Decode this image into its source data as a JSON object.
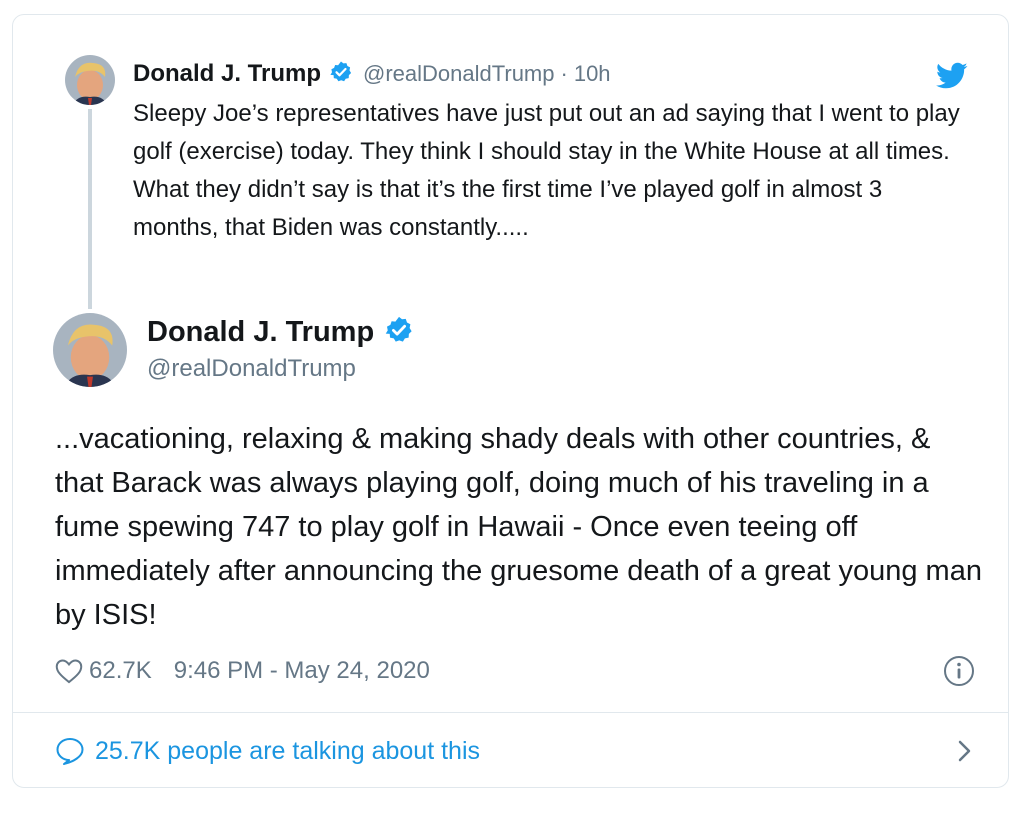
{
  "parent_tweet": {
    "author_name": "Donald J. Trump",
    "handle": "@realDonaldTrump",
    "separator": "·",
    "time_ago": "10h",
    "text": "Sleepy Joe’s representatives have just put out an ad saying that I went to play golf (exercise) today. They think I should stay in the White House at all times. What they didn’t say is that it’s the first time I’ve played golf in almost 3 months, that Biden was constantly.....",
    "verified_icon": "verified-badge-icon",
    "brand_icon": "twitter-bird-icon"
  },
  "main_tweet": {
    "author_name": "Donald J. Trump",
    "handle": "@realDonaldTrump",
    "text": "...vacationing, relaxing & making shady deals with other countries, & that Barack was always playing golf, doing much of his traveling in a fume spewing 747 to play golf in Hawaii - Once even teeing off immediately after announcing the gruesome death of a great young man by ISIS!",
    "likes": "62.7K",
    "timestamp": "9:46 PM - May 24, 2020",
    "talking": "25.7K people are talking about this"
  },
  "colors": {
    "brand_blue": "#1da1f2",
    "link_blue": "#1b95e0",
    "secondary_text": "#657786",
    "border": "#e1e8ed"
  }
}
